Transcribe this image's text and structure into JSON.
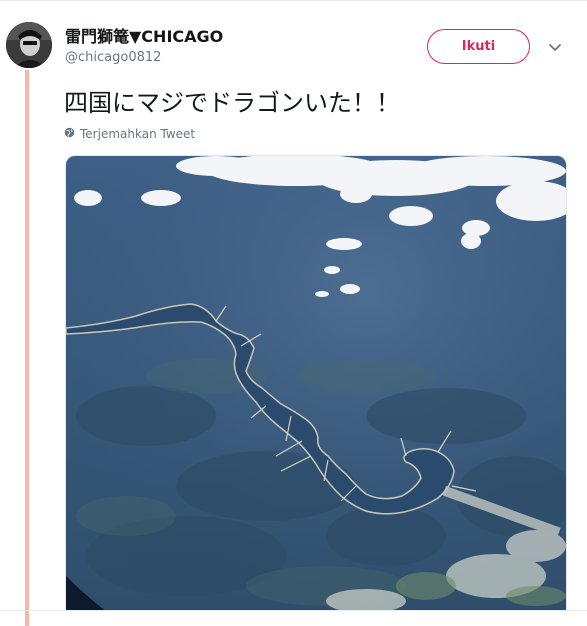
{
  "tweet": {
    "display_name": "雷門獅篭▼CHICAGO",
    "handle": "@chicago0812",
    "follow_label": "Ikuti",
    "text": "四国にマジでドラゴンいた！！",
    "translate_label": "Terjemahkan Tweet"
  },
  "colors": {
    "follow_accent": "#e0245e",
    "thread_line": "#f6b7a4",
    "secondary_text": "#657786"
  },
  "icons": {
    "menu": "chevron-down-icon",
    "translate": "globe-icon"
  }
}
